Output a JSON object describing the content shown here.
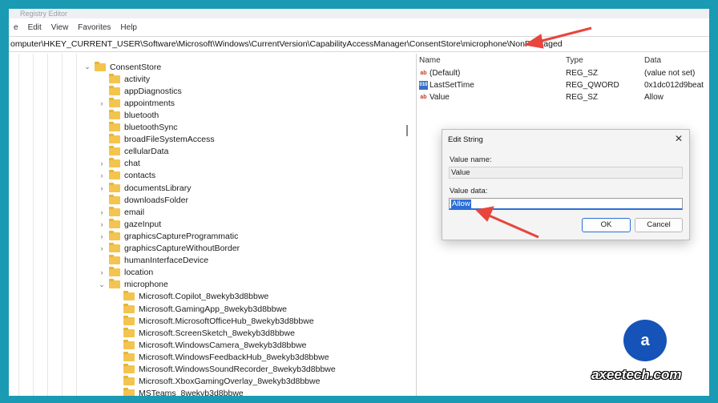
{
  "window": {
    "title": "Registry Editor"
  },
  "menu": [
    "e",
    "Edit",
    "View",
    "Favorites",
    "Help"
  ],
  "address": "omputer\\HKEY_CURRENT_USER\\Software\\Microsoft\\Windows\\CurrentVersion\\CapabilityAccessManager\\ConsentStore\\microphone\\NonPackaged",
  "tree": {
    "root": "ConsentStore",
    "items": [
      {
        "label": "activity",
        "chev": ""
      },
      {
        "label": "appDiagnostics",
        "chev": ""
      },
      {
        "label": "appointments",
        "chev": "›"
      },
      {
        "label": "bluetooth",
        "chev": ""
      },
      {
        "label": "bluetoothSync",
        "chev": ""
      },
      {
        "label": "broadFileSystemAccess",
        "chev": ""
      },
      {
        "label": "cellularData",
        "chev": ""
      },
      {
        "label": "chat",
        "chev": "›"
      },
      {
        "label": "contacts",
        "chev": "›"
      },
      {
        "label": "documentsLibrary",
        "chev": "›"
      },
      {
        "label": "downloadsFolder",
        "chev": ""
      },
      {
        "label": "email",
        "chev": "›"
      },
      {
        "label": "gazeInput",
        "chev": "›"
      },
      {
        "label": "graphicsCaptureProgrammatic",
        "chev": "›"
      },
      {
        "label": "graphicsCaptureWithoutBorder",
        "chev": "›"
      },
      {
        "label": "humanInterfaceDevice",
        "chev": ""
      },
      {
        "label": "location",
        "chev": "›"
      },
      {
        "label": "microphone",
        "chev": "⌄"
      }
    ],
    "mic_children": [
      "Microsoft.Copilot_8wekyb3d8bbwe",
      "Microsoft.GamingApp_8wekyb3d8bbwe",
      "Microsoft.MicrosoftOfficeHub_8wekyb3d8bbwe",
      "Microsoft.ScreenSketch_8wekyb3d8bbwe",
      "Microsoft.WindowsCamera_8wekyb3d8bbwe",
      "Microsoft.WindowsFeedbackHub_8wekyb3d8bbwe",
      "Microsoft.WindowsSoundRecorder_8wekyb3d8bbwe",
      "Microsoft.XboxGamingOverlay_8wekyb3d8bbwe",
      "MSTeams_8wekyb3d8bbwe"
    ]
  },
  "list": {
    "headers": {
      "name": "Name",
      "type": "Type",
      "data": "Data"
    },
    "rows": [
      {
        "icon": "ab",
        "name": "(Default)",
        "type": "REG_SZ",
        "data": "(value not set)"
      },
      {
        "icon": "010",
        "name": "LastSetTime",
        "type": "REG_QWORD",
        "data": "0x1dc012d9beat"
      },
      {
        "icon": "ab",
        "name": "Value",
        "type": "REG_SZ",
        "data": "Allow"
      }
    ]
  },
  "dialog": {
    "title": "Edit String",
    "close": "✕",
    "value_name_label": "Value name:",
    "value_name": "Value",
    "value_data_label": "Value data:",
    "value_data": "Allow",
    "ok": "OK",
    "cancel": "Cancel"
  },
  "watermark": "axeetech.com",
  "colors": {
    "background": "#1a9bb3",
    "arrow": "#e8453c",
    "selection": "#2b6fd6"
  }
}
